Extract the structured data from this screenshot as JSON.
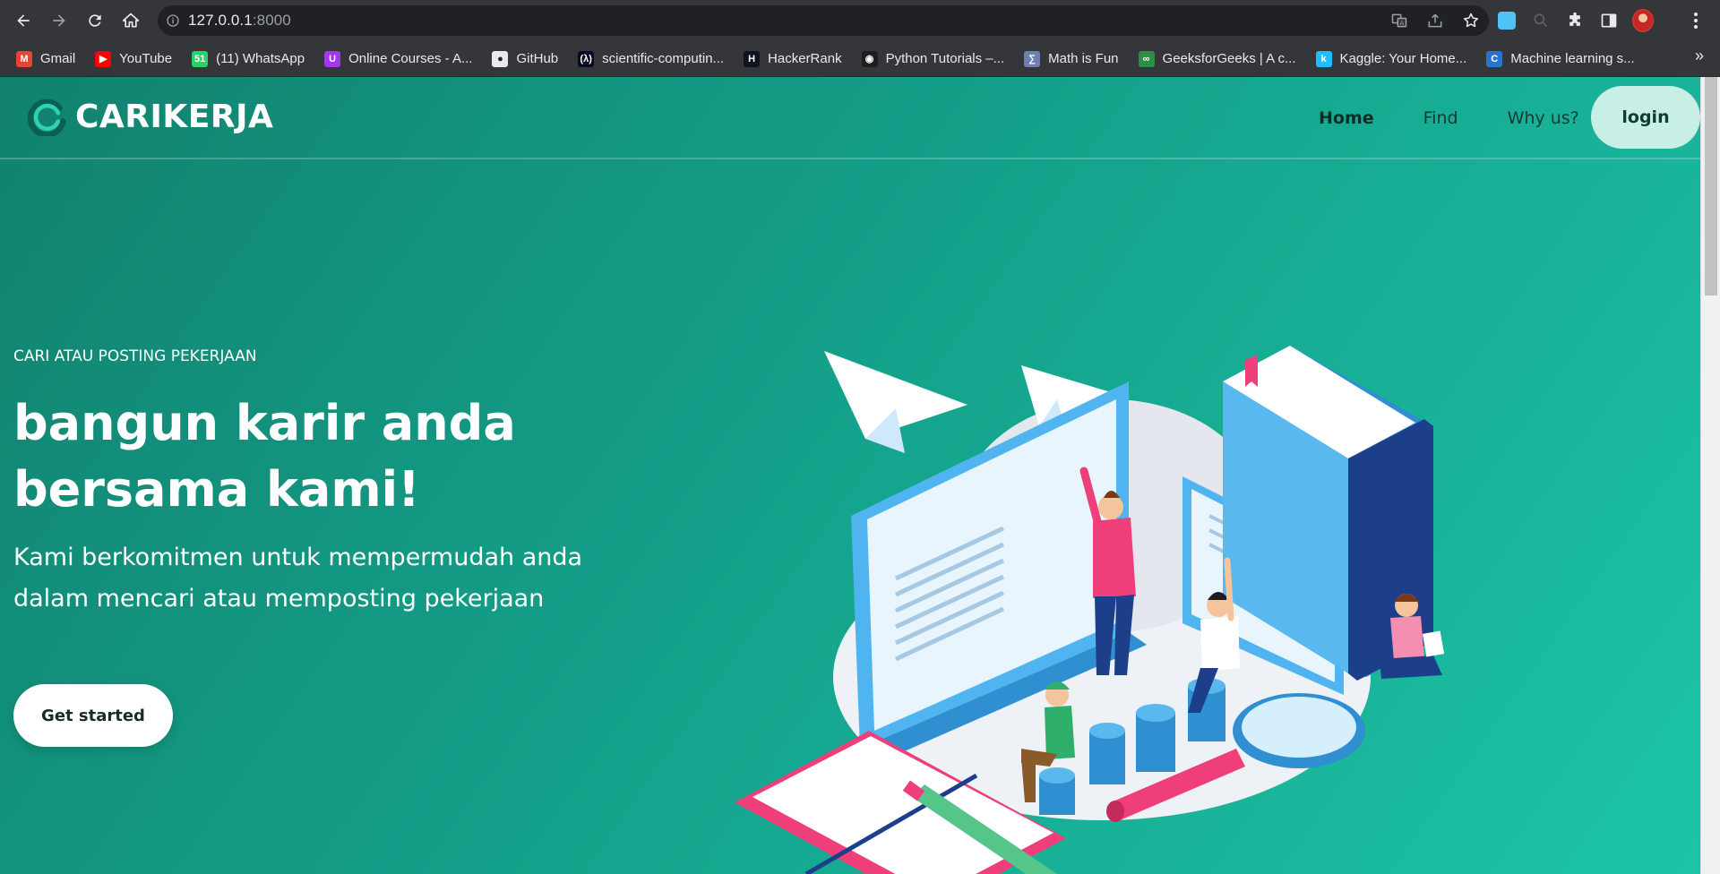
{
  "browser": {
    "url_host": "127.0.0.1",
    "url_port": ":8000",
    "bookmarks": [
      {
        "label": "Gmail",
        "icon": "gmail-icon",
        "color": "#ea4335",
        "glyph": "M"
      },
      {
        "label": "YouTube",
        "icon": "youtube-icon",
        "color": "#ff0000",
        "glyph": "▶"
      },
      {
        "label": "(11) WhatsApp",
        "icon": "whatsapp-icon",
        "color": "#25d366",
        "glyph": "51"
      },
      {
        "label": "Online Courses - A...",
        "icon": "udemy-icon",
        "color": "#a435f0",
        "glyph": "U"
      },
      {
        "label": "GitHub",
        "icon": "github-icon",
        "color": "#e8eaed",
        "glyph": "●"
      },
      {
        "label": "scientific-computin...",
        "icon": "freecodecamp-icon",
        "color": "#0a0a23",
        "glyph": "(λ)"
      },
      {
        "label": "HackerRank",
        "icon": "hackerrank-icon",
        "color": "#0e141e",
        "glyph": "H"
      },
      {
        "label": "Python Tutorials –...",
        "icon": "realpython-icon",
        "color": "#1e1e1e",
        "glyph": "◉"
      },
      {
        "label": "Math is Fun",
        "icon": "mathisfun-icon",
        "color": "#6c7fb0",
        "glyph": "∑"
      },
      {
        "label": "GeeksforGeeks | A c...",
        "icon": "geeksforgeeks-icon",
        "color": "#2f8d46",
        "glyph": "∞"
      },
      {
        "label": "Kaggle: Your Home...",
        "icon": "kaggle-icon",
        "color": "#20beff",
        "glyph": "k"
      },
      {
        "label": "Machine learning s...",
        "icon": "coursera-icon",
        "color": "#2a73cc",
        "glyph": "C"
      }
    ],
    "more_bookmarks": "»"
  },
  "site": {
    "brand": "CARIKERJA",
    "nav": [
      {
        "label": "Home",
        "active": true
      },
      {
        "label": "Find",
        "active": false
      },
      {
        "label": "Why us?",
        "active": false
      }
    ],
    "login_label": "login"
  },
  "hero": {
    "eyebrow": "CARI ATAU POSTING PEKERJAAN",
    "headline": "bangun karir anda bersama kami!",
    "subtitle": "Kami berkomitmen untuk mempermudah anda dalam mencari atau memposting pekerjaan",
    "cta_label": "Get started"
  },
  "colors": {
    "hero_gradient_start": "#11826f",
    "hero_gradient_end": "#1dc4a6",
    "login_bg": "#c8efe6",
    "accent_pink": "#ef3f7a",
    "accent_blue": "#42a9ee"
  }
}
